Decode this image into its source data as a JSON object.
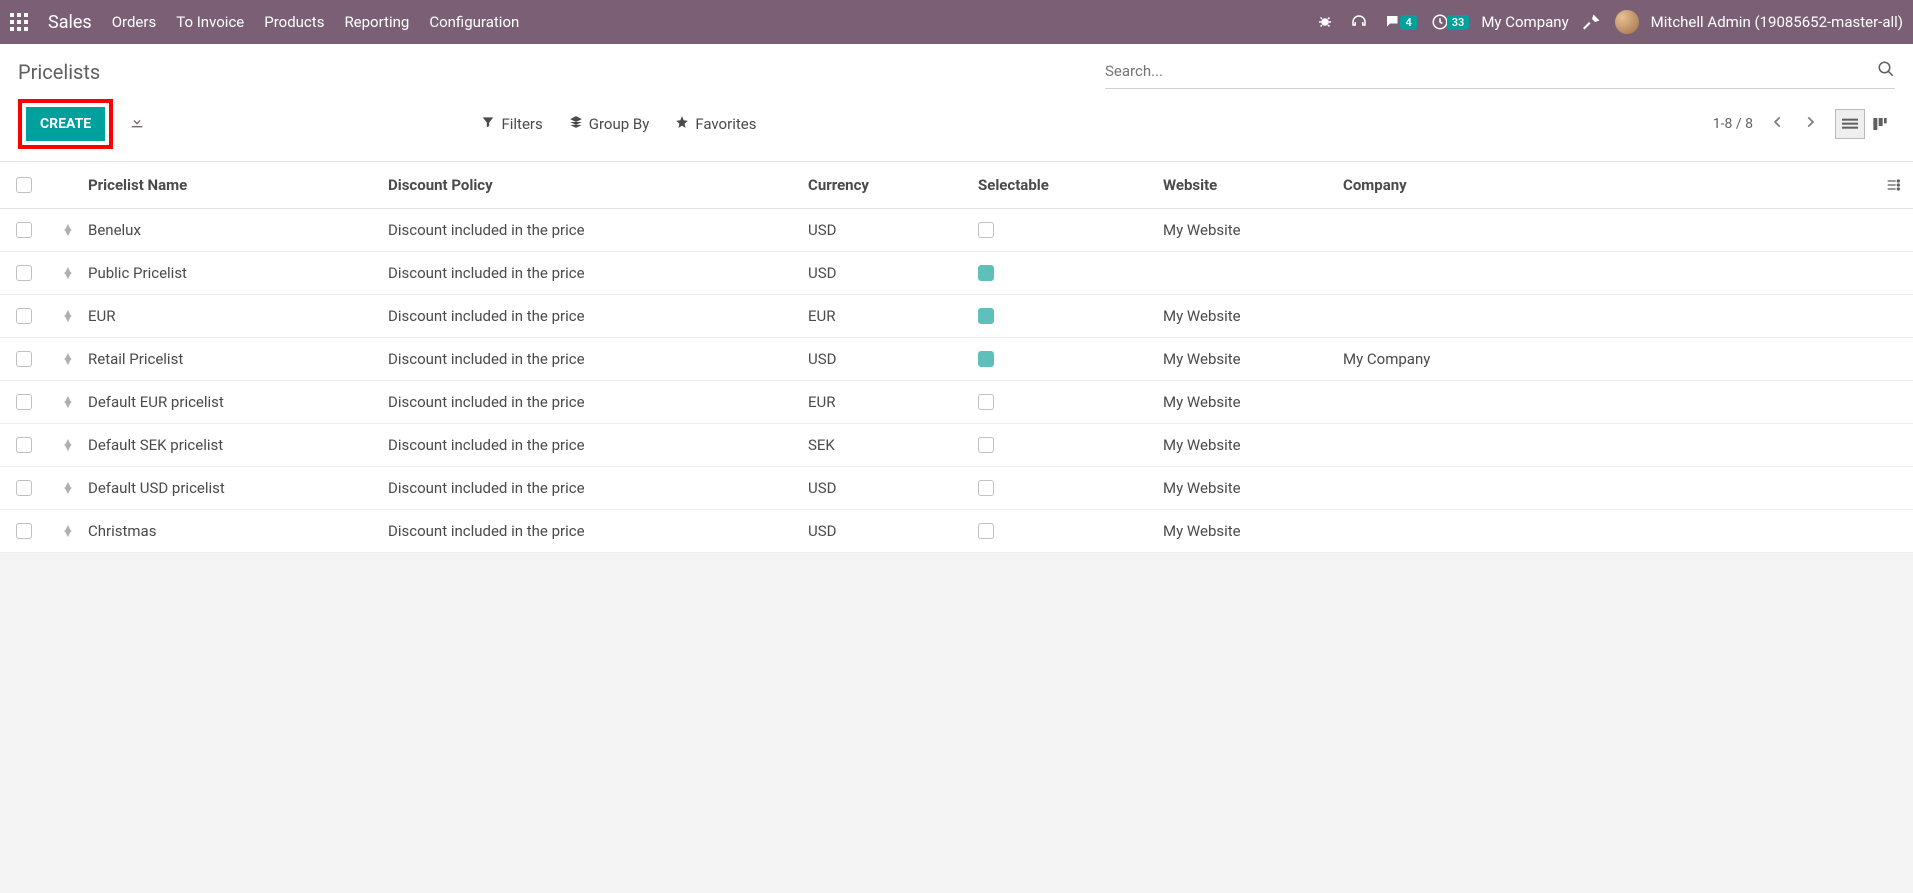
{
  "topbar": {
    "brand": "Sales",
    "nav": [
      "Orders",
      "To Invoice",
      "Products",
      "Reporting",
      "Configuration"
    ],
    "conversations_badge": "4",
    "activities_badge": "33",
    "company": "My Company",
    "user": "Mitchell Admin (19085652-master-all)"
  },
  "page": {
    "title": "Pricelists",
    "search_placeholder": "Search...",
    "create": "CREATE",
    "filters": "Filters",
    "groupby": "Group By",
    "favorites": "Favorites",
    "pager": "1-8 / 8"
  },
  "columns": {
    "name": "Pricelist Name",
    "disc": "Discount Policy",
    "curr": "Currency",
    "sel": "Selectable",
    "web": "Website",
    "comp": "Company"
  },
  "rows": [
    {
      "name": "Benelux",
      "disc": "Discount included in the price",
      "curr": "USD",
      "sel": false,
      "web": "My Website",
      "comp": ""
    },
    {
      "name": "Public Pricelist",
      "disc": "Discount included in the price",
      "curr": "USD",
      "sel": true,
      "web": "",
      "comp": ""
    },
    {
      "name": "EUR",
      "disc": "Discount included in the price",
      "curr": "EUR",
      "sel": true,
      "web": "My Website",
      "comp": ""
    },
    {
      "name": "Retail Pricelist",
      "disc": "Discount included in the price",
      "curr": "USD",
      "sel": true,
      "web": "My Website",
      "comp": "My Company"
    },
    {
      "name": "Default EUR pricelist",
      "disc": "Discount included in the price",
      "curr": "EUR",
      "sel": false,
      "web": "My Website",
      "comp": ""
    },
    {
      "name": "Default SEK pricelist",
      "disc": "Discount included in the price",
      "curr": "SEK",
      "sel": false,
      "web": "My Website",
      "comp": ""
    },
    {
      "name": "Default USD pricelist",
      "disc": "Discount included in the price",
      "curr": "USD",
      "sel": false,
      "web": "My Website",
      "comp": ""
    },
    {
      "name": "Christmas",
      "disc": "Discount included in the price",
      "curr": "USD",
      "sel": false,
      "web": "My Website",
      "comp": ""
    }
  ]
}
